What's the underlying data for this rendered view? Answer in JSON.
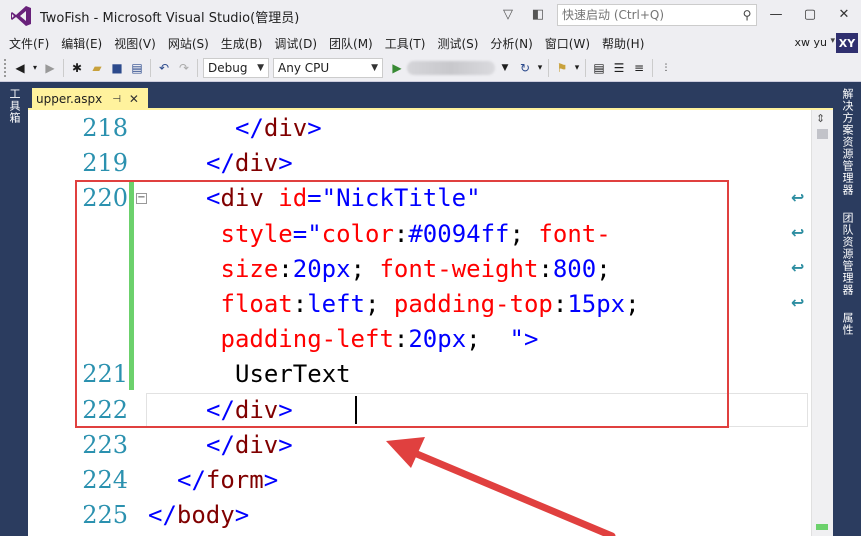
{
  "window": {
    "title": "TwoFish - Microsoft Visual Studio(管理员)",
    "quick_launch_placeholder": "快速启动 (Ctrl+Q)",
    "controls": {
      "minimize": "—",
      "restore": "▢",
      "close": "✕"
    }
  },
  "menu": {
    "items": [
      "文件(F)",
      "编辑(E)",
      "视图(V)",
      "网站(S)",
      "生成(B)",
      "调试(D)",
      "团队(M)",
      "工具(T)",
      "测试(S)",
      "分析(N)",
      "窗口(W)",
      "帮助(H)"
    ],
    "user_name": "xw yu",
    "avatar_initials": "XY"
  },
  "toolbar": {
    "config_value": "Debug",
    "platform_value": "Any CPU"
  },
  "left_strip": {
    "label": "工具箱"
  },
  "right_strip": {
    "labels": [
      "解决方案资源管理器",
      "团队资源管理器",
      "属性"
    ]
  },
  "tabs": [
    {
      "label": "upper.aspx",
      "pin": "⊣",
      "close": "✕"
    }
  ],
  "editor": {
    "line_numbers": [
      "218",
      "219",
      "220",
      "",
      "",
      "",
      "",
      "221",
      "222",
      "223",
      "224",
      "225"
    ],
    "lines": [
      {
        "tokens": [
          {
            "t": "brk",
            "v": "</"
          },
          {
            "t": "tag",
            "v": "div"
          },
          {
            "t": "brk",
            "v": ">"
          }
        ],
        "indent": 6
      },
      {
        "tokens": [
          {
            "t": "brk",
            "v": "</"
          },
          {
            "t": "tag",
            "v": "div"
          },
          {
            "t": "brk",
            "v": ">"
          }
        ],
        "indent": 4
      },
      {
        "tokens": [
          {
            "t": "brk",
            "v": "<"
          },
          {
            "t": "tag",
            "v": "div"
          },
          {
            "t": "txt",
            "v": " "
          },
          {
            "t": "attr",
            "v": "id"
          },
          {
            "t": "brk",
            "v": "="
          },
          {
            "t": "val",
            "v": "\"NickTitle\""
          }
        ],
        "indent": 4
      },
      {
        "tokens": [
          {
            "t": "attr",
            "v": "style"
          },
          {
            "t": "brk",
            "v": "=\""
          },
          {
            "t": "cssn",
            "v": "color"
          },
          {
            "t": "txt",
            "v": ":"
          },
          {
            "t": "cssv",
            "v": "#0094ff"
          },
          {
            "t": "txt",
            "v": "; "
          },
          {
            "t": "cssn",
            "v": "font-"
          }
        ],
        "indent": 5
      },
      {
        "tokens": [
          {
            "t": "cssn",
            "v": "size"
          },
          {
            "t": "txt",
            "v": ":"
          },
          {
            "t": "cssv",
            "v": "20px"
          },
          {
            "t": "txt",
            "v": "; "
          },
          {
            "t": "cssn",
            "v": "font-weight"
          },
          {
            "t": "txt",
            "v": ":"
          },
          {
            "t": "cssv",
            "v": "800"
          },
          {
            "t": "txt",
            "v": ";"
          }
        ],
        "indent": 5
      },
      {
        "tokens": [
          {
            "t": "cssn",
            "v": "float"
          },
          {
            "t": "txt",
            "v": ":"
          },
          {
            "t": "cssv",
            "v": "left"
          },
          {
            "t": "txt",
            "v": "; "
          },
          {
            "t": "cssn",
            "v": "padding-top"
          },
          {
            "t": "txt",
            "v": ":"
          },
          {
            "t": "cssv",
            "v": "15px"
          },
          {
            "t": "txt",
            "v": ";"
          }
        ],
        "indent": 5
      },
      {
        "tokens": [
          {
            "t": "cssn",
            "v": "padding-left"
          },
          {
            "t": "txt",
            "v": ":"
          },
          {
            "t": "cssv",
            "v": "20px"
          },
          {
            "t": "txt",
            "v": ";  "
          },
          {
            "t": "brk",
            "v": "\">"
          }
        ],
        "indent": 5
      },
      {
        "tokens": [
          {
            "t": "txt",
            "v": "UserText"
          }
        ],
        "indent": 6
      },
      {
        "tokens": [
          {
            "t": "brk",
            "v": "</"
          },
          {
            "t": "tag",
            "v": "div"
          },
          {
            "t": "brk",
            "v": ">"
          }
        ],
        "indent": 4
      },
      {
        "tokens": [
          {
            "t": "brk",
            "v": "</"
          },
          {
            "t": "tag",
            "v": "div"
          },
          {
            "t": "brk",
            "v": ">"
          }
        ],
        "indent": 4
      },
      {
        "tokens": [
          {
            "t": "brk",
            "v": "</"
          },
          {
            "t": "tag",
            "v": "form"
          },
          {
            "t": "brk",
            "v": ">"
          }
        ],
        "indent": 2
      },
      {
        "tokens": [
          {
            "t": "brk",
            "v": "</"
          },
          {
            "t": "tag",
            "v": "body"
          },
          {
            "t": "brk",
            "v": ">"
          }
        ],
        "indent": 0
      }
    ]
  },
  "colors": {
    "accent": "#68217a",
    "tab_active": "#fff29d",
    "frame": "#2b3c5f",
    "annotation": "#e0403f",
    "change_marker": "#6cd16c"
  }
}
